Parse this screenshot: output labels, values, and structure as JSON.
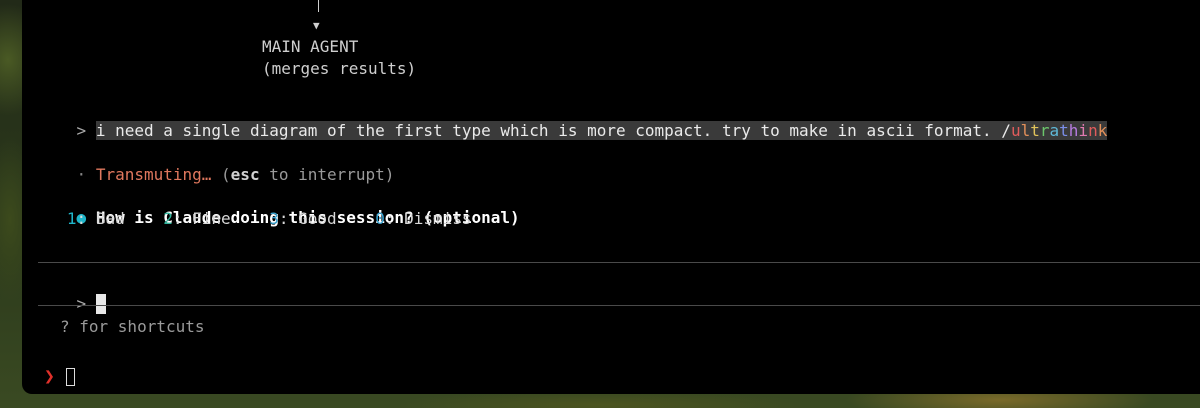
{
  "diagram": {
    "node_label": "MAIN AGENT",
    "node_sub": "(merges results)"
  },
  "user_message": {
    "prompt": ">",
    "text": "i need a single diagram of the first type which is more compact. try to make in ascii format. /",
    "rainbow_word": [
      "u",
      "l",
      "t",
      "r",
      "a",
      "t",
      "h",
      "i",
      "n",
      "k"
    ]
  },
  "status": {
    "dot": "·",
    "label": "Transmuting…",
    "hint_open": " (",
    "hint_key": "esc",
    "hint_rest": " to interrupt)"
  },
  "feedback": {
    "bullet": "●",
    "question": "How is Claude doing this session? (optional)",
    "options": [
      {
        "key": "1",
        "label": ": Bad"
      },
      {
        "key": "2",
        "label": ": Fine"
      },
      {
        "key": "3",
        "label": ": Good"
      },
      {
        "key": "0",
        "label": ": Dismiss"
      }
    ]
  },
  "input": {
    "prompt": ">",
    "hint": "? for shortcuts"
  },
  "shell": {
    "prompt": "❯"
  }
}
